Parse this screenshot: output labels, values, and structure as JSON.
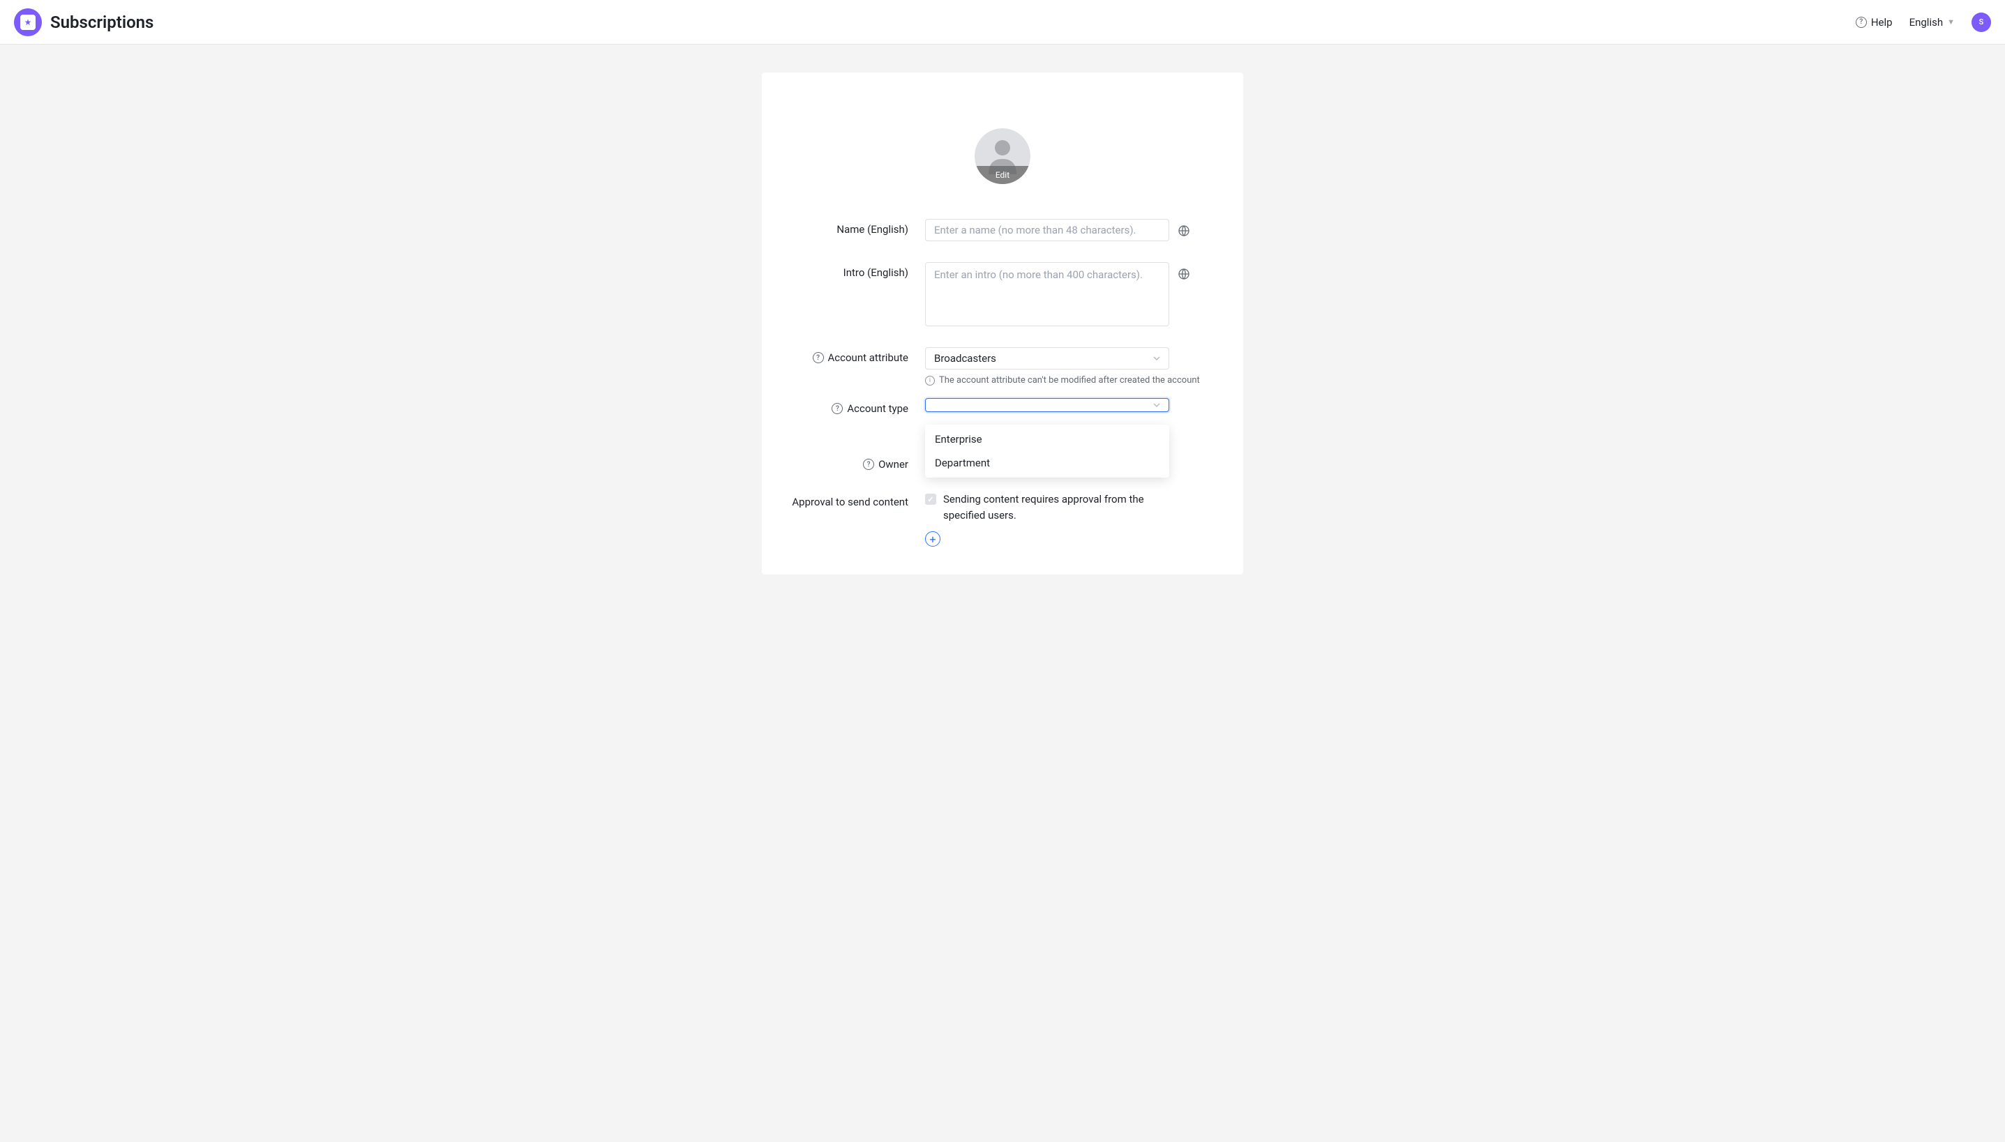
{
  "header": {
    "title": "Subscriptions",
    "help_label": "Help",
    "language_label": "English",
    "avatar_letter": "S"
  },
  "form": {
    "avatar_edit_label": "Edit",
    "name": {
      "label": "Name (English)",
      "placeholder": "Enter a name (no more than 48 characters).",
      "value": ""
    },
    "intro": {
      "label": "Intro (English)",
      "placeholder": "Enter an intro (no more than 400 characters).",
      "value": ""
    },
    "account_attribute": {
      "label": "Account attribute",
      "selected": "Broadcasters",
      "helper": "The account attribute can't be modified after created the account"
    },
    "account_type": {
      "label": "Account type",
      "selected": "",
      "options": [
        "Enterprise",
        "Department"
      ]
    },
    "owner": {
      "label": "Owner"
    },
    "approval": {
      "label": "Approval to send content",
      "checkbox_label": "Sending content requires approval from the specified users.",
      "checked": true
    }
  }
}
